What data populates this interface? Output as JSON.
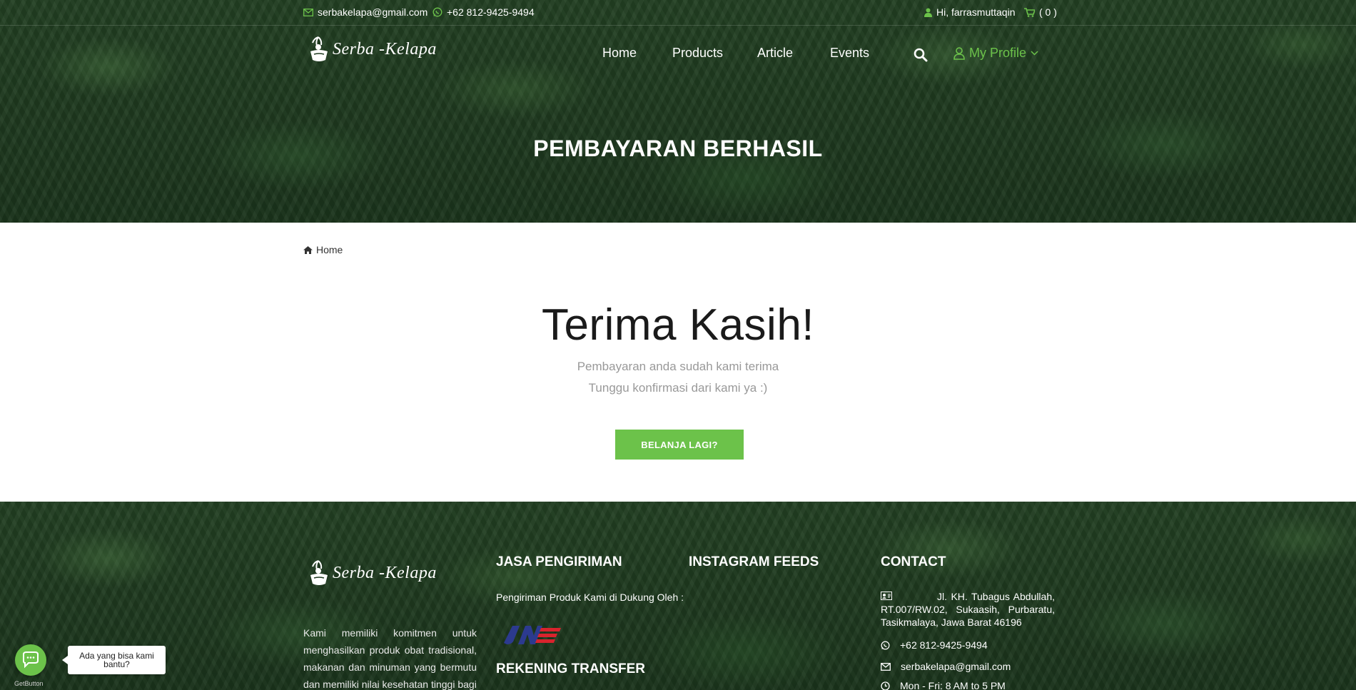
{
  "topbar": {
    "email": "serbakelapa@gmail.com",
    "phone": "+62 812-9425-9494",
    "greeting": "Hi, farrasmuttaqin",
    "cart": "( 0 )"
  },
  "brand": {
    "name": "Serba -Kelapa"
  },
  "nav": {
    "items": [
      "Home",
      "Products",
      "Article",
      "Events"
    ],
    "profile": "My Profile"
  },
  "hero": {
    "title": "PEMBAYARAN BERHASIL"
  },
  "breadcrumb": {
    "home": "Home"
  },
  "main": {
    "heading": "Terima Kasih!",
    "line1": "Pembayaran anda sudah kami terima",
    "line2": "Tunggu konfirmasi dari kami ya :)",
    "button": "BELANJA LAGI?"
  },
  "footer": {
    "about": "Kami memiliki komitmen untuk menghasilkan produk obat tradisional, makanan dan minuman yang bermutu dan memiliki nilai kesehatan tinggi bagi",
    "shipping_title": "JASA PENGIRIMAN",
    "shipping_text": "Pengiriman Produk Kami di Dukung Oleh :",
    "transfer_title": "REKENING TRANSFER",
    "instagram_title": "INSTAGRAM FEEDS",
    "contact_title": "CONTACT",
    "address": "Jl. KH. Tubagus Abdullah, RT.007/RW.02, Sukaasih, Purbaratu, Tasikmalaya, Jawa Barat 46196",
    "phone": "+62 812-9425-9494",
    "email": "serbakelapa@gmail.com",
    "hours": "Mon - Fri: 8 AM to 5 PM"
  },
  "chat": {
    "bubble": "Ada yang bisa kami bantu?",
    "provider": "GetButton"
  },
  "colors": {
    "accent": "#6cc24a",
    "bg_dark": "#1f3a1f"
  }
}
